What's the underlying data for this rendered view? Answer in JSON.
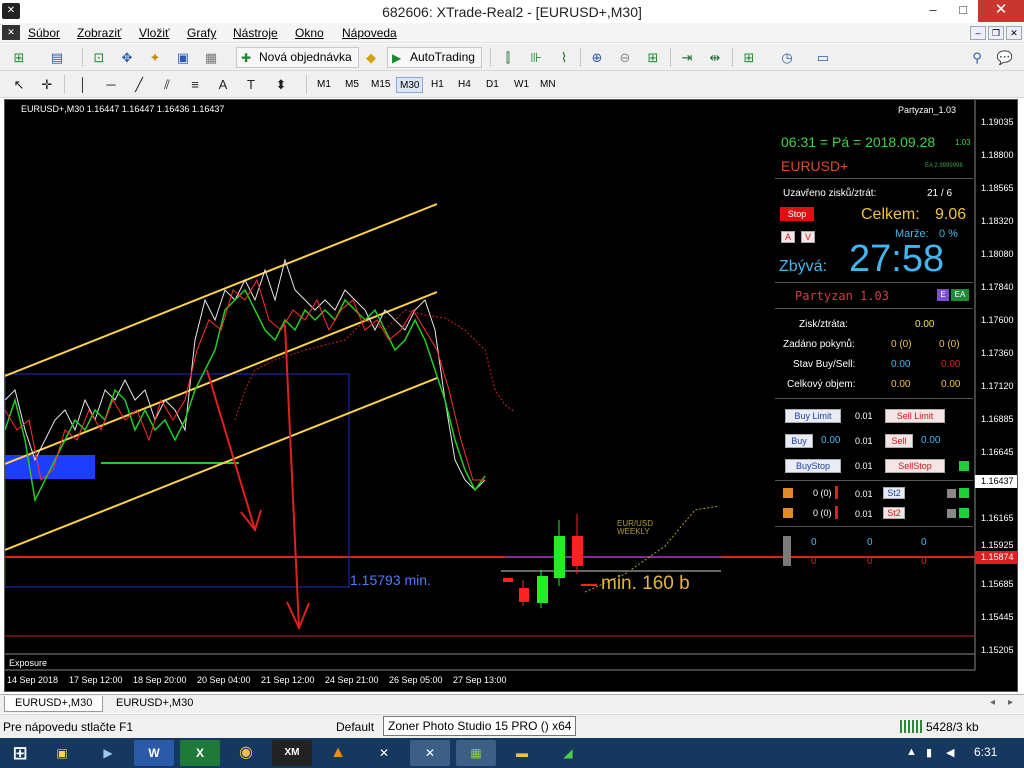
{
  "window": {
    "title": "682606: XTrade-Real2 - [EURUSD+,M30]",
    "app_icon": "mt4-app-icon",
    "minimize": "–",
    "maximize": "□",
    "close": "✕"
  },
  "menu": {
    "items": [
      "Súbor",
      "Zobraziť",
      "Vložiť",
      "Grafy",
      "Nástroje",
      "Okno",
      "Nápoveda"
    ]
  },
  "toolbar1": {
    "new_order_label": "Nová objednávka",
    "autotrading_label": "AutoTrading"
  },
  "toolbar2": {
    "timeframes": [
      "M1",
      "M5",
      "M15",
      "M30",
      "H1",
      "H4",
      "D1",
      "W1",
      "MN"
    ],
    "active_timeframe": "M30"
  },
  "chart": {
    "header": "EURUSD+,M30  1.16447 1.16447 1.16436 1.16437",
    "ea_name": "Partyzan_1.03",
    "price_axis": [
      "1.19035",
      "1.18800",
      "1.18565",
      "1.18320",
      "1.18080",
      "1.17840",
      "1.17600",
      "1.17360",
      "1.17120",
      "1.16885",
      "1.16645",
      "1.16437",
      "1.16165",
      "1.15925",
      "1.15874",
      "1.15685",
      "1.15445",
      "1.15205"
    ],
    "current_price": "1.16437",
    "red_line_price": "1.15874",
    "time_axis": [
      "14 Sep 2018",
      "17 Sep 12:00",
      "18 Sep 20:00",
      "20 Sep 04:00",
      "21 Sep 12:00",
      "24 Sep 21:00",
      "26 Sep 05:00",
      "27 Sep 13:00"
    ],
    "box_label": "1.15793 min.",
    "min_label": "min. 160 b",
    "weekly_label_1": "EUR/USD",
    "weekly_label_2": "WEEKLY",
    "exposure_label": "Exposure",
    "colors": {
      "channel": "#ffd24a",
      "arrow": "#e02020",
      "box": "#1f2fc8",
      "candle_up": "#00dd00",
      "candle_down": "#ff2222"
    }
  },
  "panel": {
    "time_line": "06:31 = Pá = 2018.09.28",
    "version_small": "1.03",
    "symbol": "EURUSD+",
    "ea_small": "EA 2.9999998",
    "closed_label": "Uzavřeno zisků/ztrát:",
    "closed_value": "21 / 6",
    "stop_btn": "Stop",
    "total_label": "Celkem:",
    "total_value": "9.06",
    "margin_label": "Marže:",
    "margin_value": "0 %",
    "a_btn": "A",
    "v_btn": "V",
    "remaining_label": "Zbývá:",
    "remaining_value": "27:58",
    "name_line": "Partyzan 1.03",
    "e_badge": "E",
    "ea_badge": "EA",
    "pl_label": "Zisk/ztráta:",
    "pl_value": "0.00",
    "orders_label": "Zadáno pokynů:",
    "orders_buy": "0 (0)",
    "orders_sell": "0 (0)",
    "state_label": "Stav Buy/Sell:",
    "state_buy": "0.00",
    "state_sell": "0.00",
    "volume_label": "Celkový objem:",
    "volume_buy": "0.00",
    "volume_sell": "0.00",
    "buy_limit": "Buy Limit",
    "sell_limit": "Sell Limit",
    "lot1": "0.01",
    "buy": "Buy",
    "sell": "Sell",
    "buy_price": "0.00",
    "sell_price": "0.00",
    "lot2": "0.01",
    "buy_stop": "BuyStop",
    "sell_stop": "SellStop",
    "lot3": "0.01",
    "row_a_count": "0 (0)",
    "row_a_lot": "0.01",
    "row_a_btn": "St2",
    "row_b_count": "0 (0)",
    "row_b_lot": "0.01",
    "row_b_btn": "St2",
    "grid_top": [
      "0",
      "0",
      "0"
    ],
    "grid_bottom": [
      "0",
      "0",
      "0"
    ]
  },
  "tabs": {
    "items": [
      "EURUSD+,M30",
      "EURUSD+,M30"
    ]
  },
  "status": {
    "help": "Pre nápovedu stlačte F1",
    "profile": "Default",
    "tooltip": "Zoner Photo Studio 15 PRO  () x64",
    "traffic": "5428/3 kb"
  },
  "taskbar": {
    "apps": [
      "start-icon",
      "explorer-icon",
      "media-icon",
      "word-icon",
      "excel-icon",
      "chrome-icon",
      "xm-icon",
      "vlc-icon",
      "xtrade-icon",
      "mt4-icon",
      "zoner-icon",
      "folder-icon",
      "chart-app-icon"
    ],
    "xm_label": "XM",
    "word_label": "W",
    "excel_label": "X",
    "clock": "6:31"
  }
}
